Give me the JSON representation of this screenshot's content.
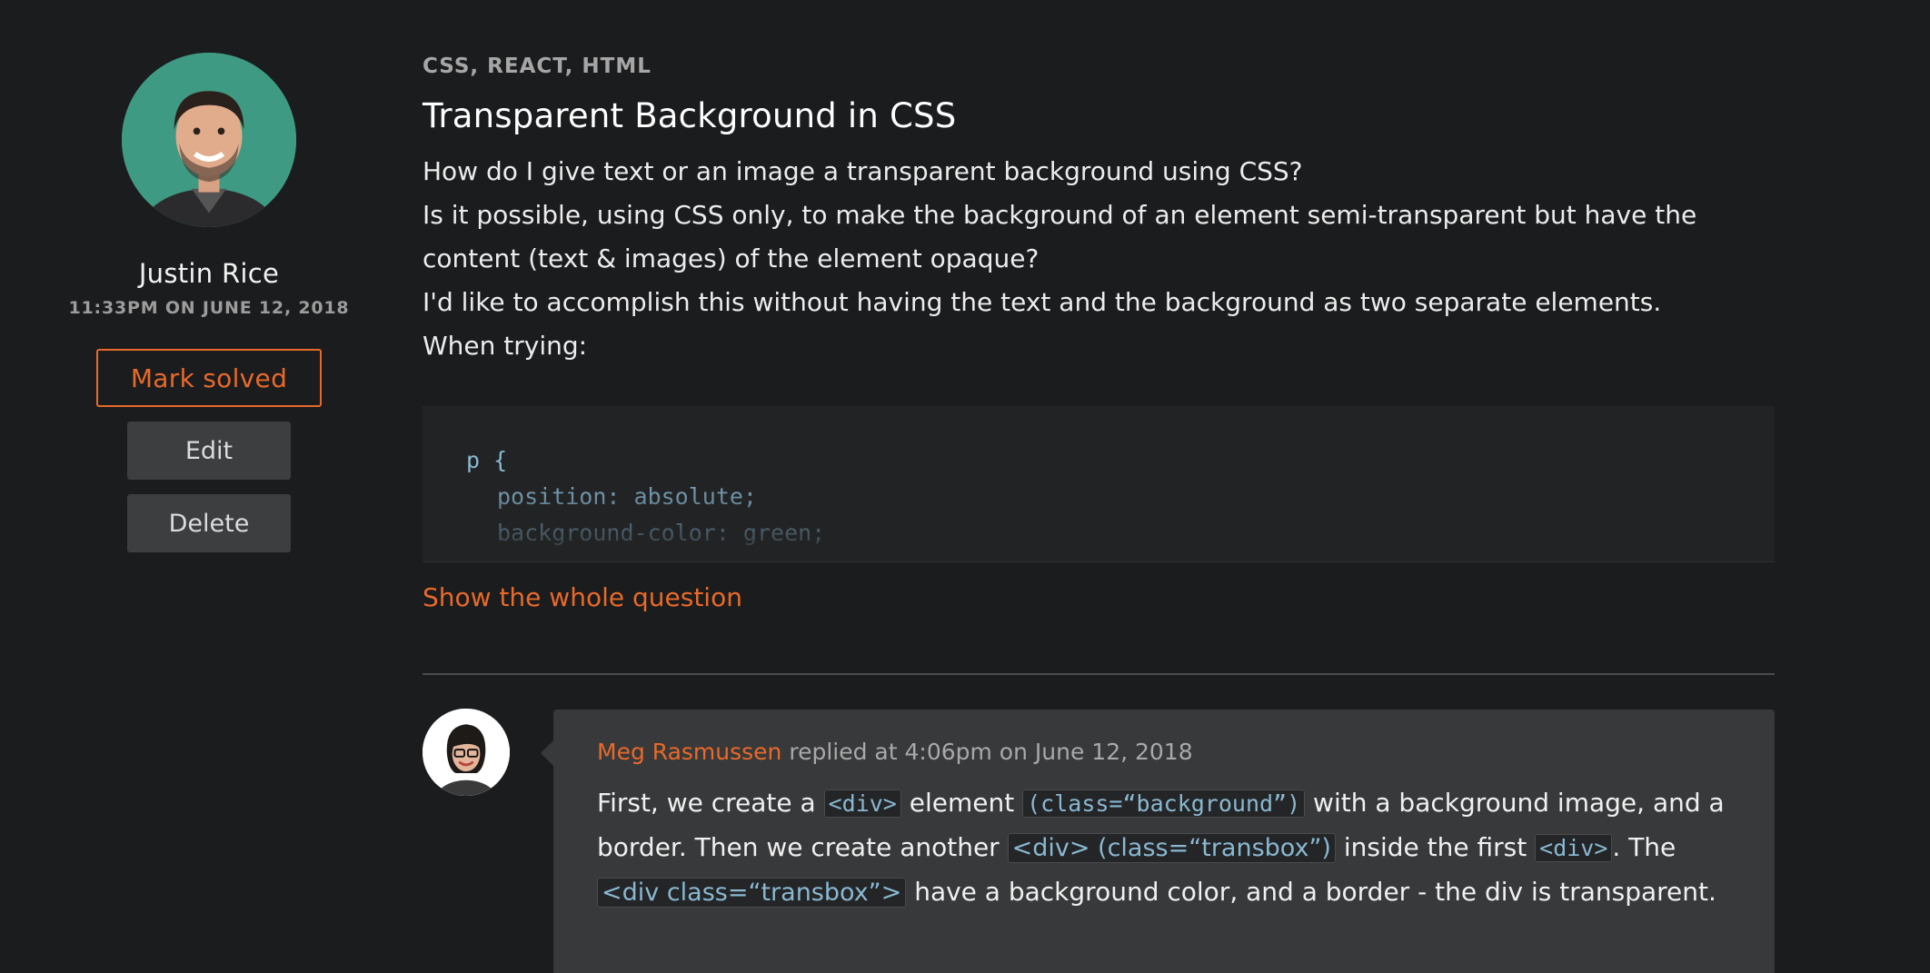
{
  "author": {
    "name": "Justin Rice",
    "timestamp": "11:33PM ON JUNE 12, 2018"
  },
  "actions": {
    "mark_solved": "Mark solved",
    "edit": "Edit",
    "delete": "Delete"
  },
  "question": {
    "tags": "CSS, REACT, HTML",
    "title": "Transparent Background in CSS",
    "lines": [
      "How do I give text or an image a transparent background using CSS?",
      "Is it possible, using CSS only, to make the background of an element semi-transparent but have the",
      "content (text & images) of the element opaque?",
      "I'd like to accomplish this without having the text and the background as two separate elements.",
      "When trying:"
    ],
    "code": [
      "p {",
      "position: absolute;",
      "background-color: green;"
    ],
    "show_more": "Show the whole question"
  },
  "reply": {
    "author": "Meg Rasmussen",
    "meta_suffix": "replied at 4:06pm on June 12, 2018",
    "text": {
      "t1": "First, we create a ",
      "c1": "<div>",
      "t2": " element ",
      "c2": "(class=“background”)",
      "t3": " with a background image, and a border. Then we create another ",
      "c3": "<div> (class=“transbox”)",
      "t4": " inside the first ",
      "c4": "<div>",
      "t5": ". The ",
      "c5": "<div class=“transbox”>",
      "t6": " have a background color, and a border - the div is transparent."
    }
  },
  "colors": {
    "background": "#1b1c1e",
    "accent": "#e8692a",
    "code": "#89b8d1",
    "card": "#38393b"
  },
  "icons": {
    "author_avatar": "avatar-photo",
    "reply_avatar": "avatar-photo"
  }
}
